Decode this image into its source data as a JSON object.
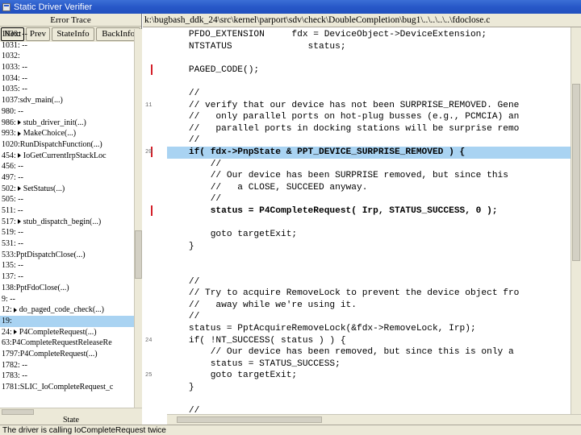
{
  "window": {
    "title": "Static Driver Verifier"
  },
  "left_pane": {
    "header": "Error Trace",
    "buttons": {
      "next": "Next",
      "prev": "Prev",
      "state_info": "StateInfo",
      "back_info": "BackInfo"
    },
    "trace_rows": [
      {
        "text": "1030: --",
        "arrow": false,
        "selected": false
      },
      {
        "text": "1031: --",
        "arrow": false,
        "selected": false
      },
      {
        "text": "1032:",
        "arrow": false,
        "selected": false
      },
      {
        "text": "1033: --",
        "arrow": false,
        "selected": false
      },
      {
        "text": "1034: --",
        "arrow": false,
        "selected": false
      },
      {
        "text": "1035: --",
        "arrow": false,
        "selected": false
      },
      {
        "text": "1037:sdv_main(...)",
        "arrow": false,
        "selected": false
      },
      {
        "text": "980: --",
        "arrow": false,
        "selected": false
      },
      {
        "text": "986:",
        "arrow": true,
        "label": "stub_driver_init(...)",
        "selected": false
      },
      {
        "text": "993:",
        "arrow": true,
        "label": "MakeChoice(...)",
        "selected": false
      },
      {
        "text": "1020:RunDispatchFunction(...)",
        "arrow": false,
        "selected": false
      },
      {
        "text": "454:",
        "arrow": true,
        "label": "IoGetCurrentIrpStackLoc",
        "selected": false
      },
      {
        "text": "456: --",
        "arrow": false,
        "selected": false
      },
      {
        "text": "497: --",
        "arrow": false,
        "selected": false
      },
      {
        "text": "502:",
        "arrow": true,
        "label": "SetStatus(...)",
        "selected": false
      },
      {
        "text": "505: --",
        "arrow": false,
        "selected": false
      },
      {
        "text": "511: --",
        "arrow": false,
        "selected": false
      },
      {
        "text": "517:",
        "arrow": true,
        "label": "stub_dispatch_begin(...)",
        "selected": false
      },
      {
        "text": "519: --",
        "arrow": false,
        "selected": false
      },
      {
        "text": "531: --",
        "arrow": false,
        "selected": false
      },
      {
        "text": "533:PptDispatchClose(...)",
        "arrow": false,
        "selected": false
      },
      {
        "text": "135: --",
        "arrow": false,
        "selected": false
      },
      {
        "text": "137: --",
        "arrow": false,
        "selected": false
      },
      {
        "text": "138:PptFdoClose(...)",
        "arrow": false,
        "selected": false
      },
      {
        "text": "9: --",
        "arrow": false,
        "selected": false
      },
      {
        "text": "12:",
        "arrow": true,
        "label": "do_paged_code_check(...)",
        "selected": false
      },
      {
        "text": "19:",
        "arrow": false,
        "selected": true
      },
      {
        "text": "24:",
        "arrow": true,
        "label": "P4CompleteRequest(...)",
        "selected": false
      },
      {
        "text": "63:P4CompleteRequestReleaseRe",
        "arrow": false,
        "selected": false
      },
      {
        "text": "1797:P4CompleteRequest(...)",
        "arrow": false,
        "selected": false
      },
      {
        "text": "1782: --",
        "arrow": false,
        "selected": false
      },
      {
        "text": "1783: --",
        "arrow": false,
        "selected": false
      },
      {
        "text": "1781:SLIC_IoCompleteRequest_c",
        "arrow": false,
        "selected": false
      }
    ],
    "state_label": "State"
  },
  "code_pane": {
    "path": "k:\\bugbash_ddk_24\\src\\kernel\\parport\\sdv\\check\\DoubleCompletion\\bug1\\..\\..\\..\\..\\fdoclose.c",
    "lines": [
      {
        "text": "    PFDO_EXTENSION     fdx = DeviceObject->DeviceExtension;",
        "hl": false,
        "bold": false
      },
      {
        "text": "    NTSTATUS              status;",
        "hl": false,
        "bold": false
      },
      {
        "text": "",
        "hl": false,
        "bold": false
      },
      {
        "text": "    PAGED_CODE();",
        "hl": false,
        "bold": false
      },
      {
        "text": "",
        "hl": false,
        "bold": false
      },
      {
        "text": "    //",
        "hl": false,
        "bold": false
      },
      {
        "text": "    // verify that our device has not been SURPRISE_REMOVED. Gene",
        "hl": false,
        "bold": false
      },
      {
        "text": "    //   only parallel ports on hot-plug busses (e.g., PCMCIA) an",
        "hl": false,
        "bold": false
      },
      {
        "text": "    //   parallel ports in docking stations will be surprise remo",
        "hl": false,
        "bold": false
      },
      {
        "text": "    //",
        "hl": false,
        "bold": false
      },
      {
        "text": "    if( fdx->PnpState & PPT_DEVICE_SURPRISE_REMOVED ) {",
        "hl": true,
        "bold": true
      },
      {
        "text": "        //",
        "hl": false,
        "bold": false
      },
      {
        "text": "        // Our device has been SURPRISE removed, but since this",
        "hl": false,
        "bold": false
      },
      {
        "text": "        //   a CLOSE, SUCCEED anyway.",
        "hl": false,
        "bold": false
      },
      {
        "text": "        //",
        "hl": false,
        "bold": false
      },
      {
        "text": "        status = P4CompleteRequest( Irp, STATUS_SUCCESS, 0 );",
        "hl": false,
        "bold": true
      },
      {
        "text": "",
        "hl": false,
        "bold": false
      },
      {
        "text": "        goto targetExit;",
        "hl": false,
        "bold": false
      },
      {
        "text": "    }",
        "hl": false,
        "bold": false
      },
      {
        "text": "",
        "hl": false,
        "bold": false
      },
      {
        "text": "",
        "hl": false,
        "bold": false
      },
      {
        "text": "    //",
        "hl": false,
        "bold": false
      },
      {
        "text": "    // Try to acquire RemoveLock to prevent the device object fro",
        "hl": false,
        "bold": false
      },
      {
        "text": "    //   away while we're using it.",
        "hl": false,
        "bold": false
      },
      {
        "text": "    //",
        "hl": false,
        "bold": false
      },
      {
        "text": "    status = PptAcquireRemoveLock(&fdx->RemoveLock, Irp);",
        "hl": false,
        "bold": false
      },
      {
        "text": "    if( !NT_SUCCESS( status ) ) {",
        "hl": false,
        "bold": false
      },
      {
        "text": "        // Our device has been removed, but since this is only a",
        "hl": false,
        "bold": false
      },
      {
        "text": "        status = STATUS_SUCCESS;",
        "hl": false,
        "bold": false
      },
      {
        "text": "        goto targetExit;",
        "hl": false,
        "bold": false
      },
      {
        "text": "    }",
        "hl": false,
        "bold": false
      },
      {
        "text": "",
        "hl": false,
        "bold": false
      },
      {
        "text": "    //",
        "hl": false,
        "bold": false
      }
    ],
    "red_marker_lines": [
      3,
      10,
      15
    ],
    "gutter_marks": {
      "6": "11",
      "10": "20",
      "26": "24",
      "29": "25"
    }
  },
  "status_bar": {
    "text": "The driver is calling IoCompleteRequest twice"
  }
}
